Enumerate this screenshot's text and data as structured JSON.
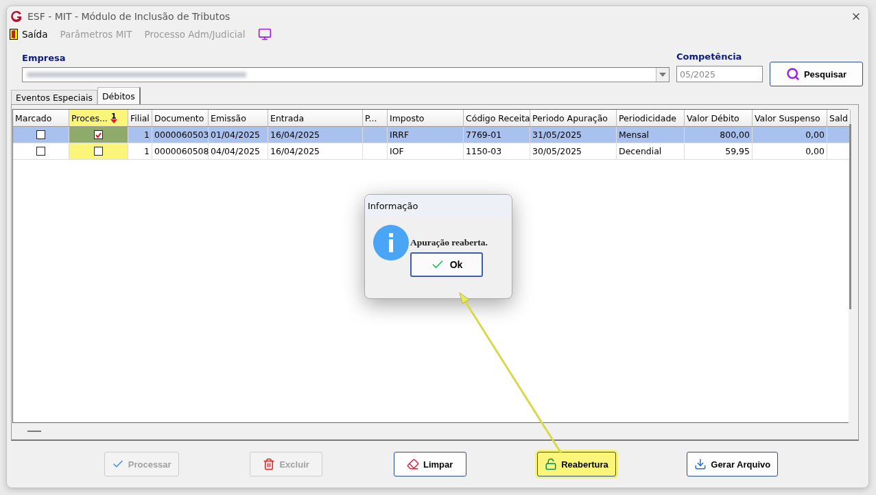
{
  "window": {
    "title": "ESF - MIT - Módulo de Inclusão de Tributos"
  },
  "menu": [
    {
      "label": "Saída",
      "disabled": false,
      "kind": "exit"
    },
    {
      "label": "Parâmetros MIT",
      "disabled": true,
      "kind": "plain"
    },
    {
      "label": "Processo Adm/Judicial",
      "disabled": true,
      "kind": "plain"
    },
    {
      "kind": "monitor"
    }
  ],
  "empresa": {
    "label": "Empresa"
  },
  "competencia": {
    "label": "Competência",
    "value": "05/2025"
  },
  "search_button": {
    "label": "Pesquisar"
  },
  "tabs": [
    {
      "label": "Eventos Especiais",
      "selected": false
    },
    {
      "label": "Débitos",
      "selected": true
    }
  ],
  "table": {
    "columns": [
      {
        "label": "Marcado",
        "kind": "check",
        "highlighted": false
      },
      {
        "label": "Proces...",
        "kind": "check",
        "highlighted": true,
        "sort": "1"
      },
      {
        "label": "Filial",
        "kind": "number",
        "highlighted": false
      },
      {
        "label": "Documento",
        "kind": "text",
        "highlighted": false
      },
      {
        "label": "Emissão",
        "kind": "text",
        "highlighted": false
      },
      {
        "label": "Entrada",
        "kind": "text",
        "highlighted": false
      },
      {
        "label": "P...",
        "kind": "text",
        "highlighted": false
      },
      {
        "label": "Imposto",
        "kind": "text",
        "highlighted": false
      },
      {
        "label": "Código Receita",
        "kind": "text",
        "highlighted": false
      },
      {
        "label": "Periodo Apuração",
        "kind": "text",
        "highlighted": false
      },
      {
        "label": "Periodicidade",
        "kind": "text",
        "highlighted": false
      },
      {
        "label": "Valor Débito",
        "kind": "number",
        "highlighted": false
      },
      {
        "label": "Valor Suspenso",
        "kind": "number",
        "highlighted": false
      },
      {
        "label": "Sald",
        "kind": "text",
        "highlighted": false
      }
    ],
    "rows": [
      {
        "selected": true,
        "cells": [
          false,
          true,
          "1",
          "0000060503",
          "01/04/2025",
          "16/04/2025",
          null,
          "IRRF",
          "7769-01",
          "31/05/2025",
          "Mensal",
          "800,00",
          "0,00",
          null
        ]
      },
      {
        "selected": false,
        "cells": [
          false,
          false,
          "1",
          "0000060508",
          "04/04/2025",
          "16/04/2025",
          null,
          "IOF",
          "1150-03",
          "30/05/2025",
          "Decendial",
          "59,95",
          "0,00",
          null
        ]
      }
    ]
  },
  "buttons": [
    {
      "label": "Processar",
      "kind": "process",
      "disabled": true,
      "highlighted": false
    },
    {
      "label": "Excluir",
      "kind": "delete",
      "disabled": true,
      "highlighted": false
    },
    {
      "label": "Limpar",
      "kind": "clear",
      "disabled": false,
      "highlighted": false
    },
    {
      "label": "Reabertura",
      "kind": "reopen",
      "disabled": false,
      "highlighted": true
    },
    {
      "label": "Gerar Arquivo",
      "kind": "export",
      "disabled": false,
      "highlighted": false
    }
  ],
  "dialog": {
    "title": "Informação",
    "message": "Apuração reaberta.",
    "button": "Ok"
  }
}
